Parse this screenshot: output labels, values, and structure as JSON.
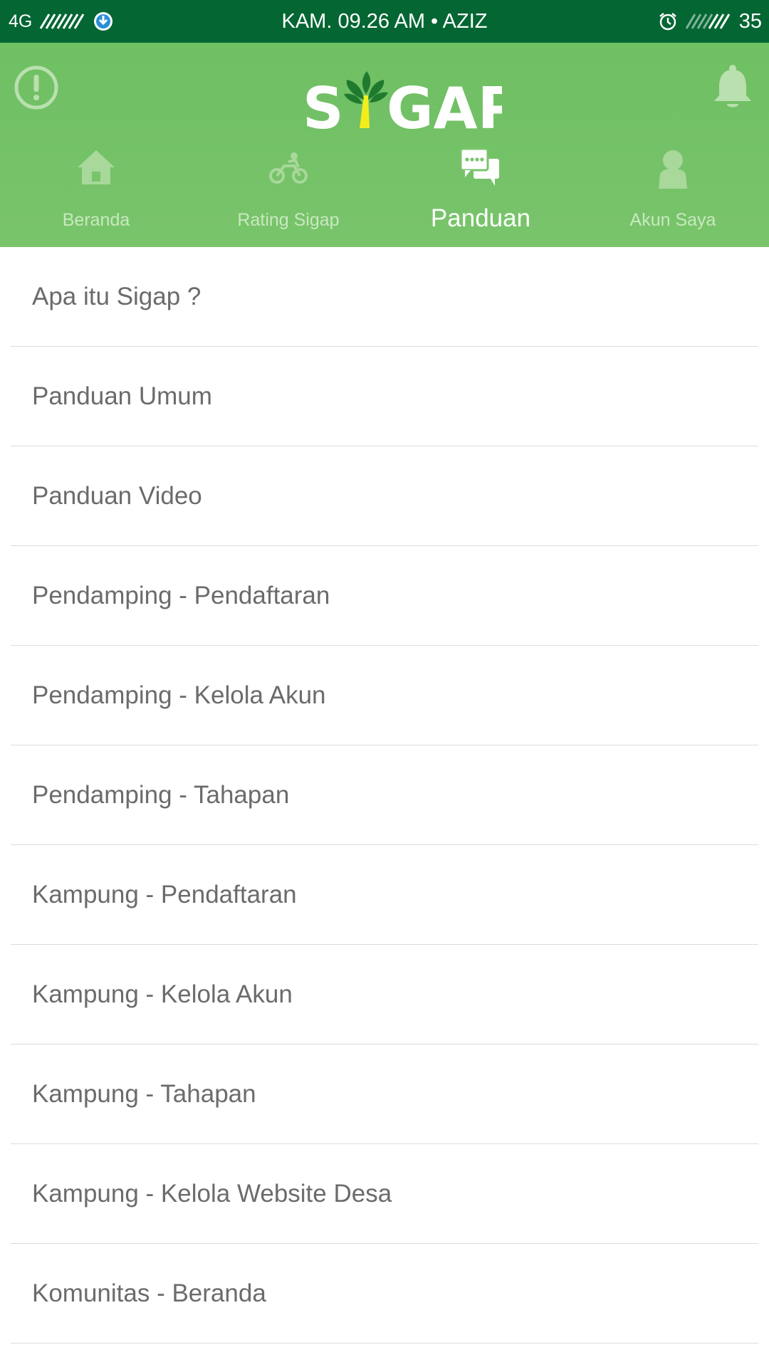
{
  "statusbar": {
    "network": "4G",
    "center": "KAM. 09.26 AM • AZIZ",
    "battery": "35",
    "icons": [
      "signal-icon",
      "download-icon",
      "alarm-icon",
      "signal-strength-icon"
    ]
  },
  "header": {
    "logo_text": "SIGAP",
    "icons": [
      "alert-icon",
      "bell-icon"
    ],
    "colors": {
      "header": "#74c266",
      "statusbar": "#036633",
      "logo_tree": "#1f7a2e",
      "logo_trunk": "#f2ee1c"
    }
  },
  "tabs": [
    {
      "label": "Beranda",
      "icon": "home-icon",
      "active": false
    },
    {
      "label": "Rating Sigap",
      "icon": "motorbike-icon",
      "active": false
    },
    {
      "label": "Panduan",
      "icon": "chat-icon",
      "active": true
    },
    {
      "label": "Akun Saya",
      "icon": "person-icon",
      "active": false
    }
  ],
  "list": {
    "items": [
      "Apa itu Sigap ?",
      "Panduan Umum",
      "Panduan Video",
      "Pendamping - Pendaftaran",
      "Pendamping - Kelola Akun",
      "Pendamping - Tahapan",
      "Kampung - Pendaftaran",
      "Kampung - Kelola Akun",
      "Kampung - Tahapan",
      "Kampung - Kelola Website Desa",
      "Komunitas - Beranda"
    ]
  }
}
